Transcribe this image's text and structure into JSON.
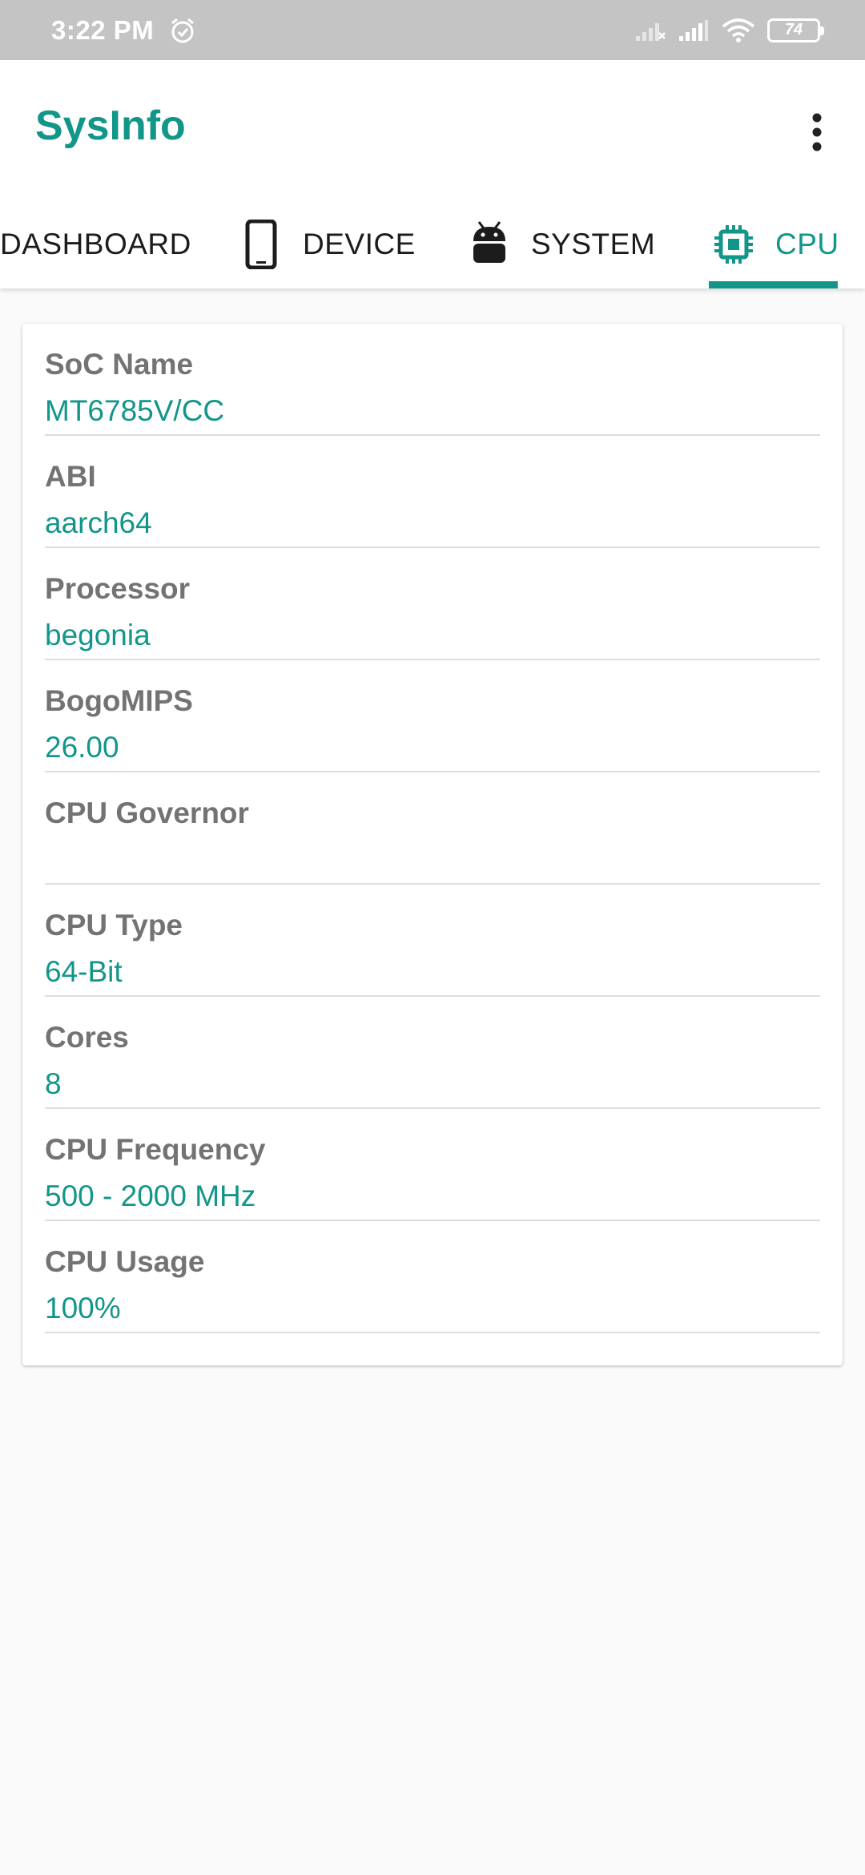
{
  "status_bar": {
    "time": "3:22 PM",
    "battery": "74"
  },
  "app": {
    "title": "SysInfo"
  },
  "tabs": [
    {
      "label": "DASHBOARD",
      "icon": "dashboard-icon",
      "active": false
    },
    {
      "label": "DEVICE",
      "icon": "phone-icon",
      "active": false
    },
    {
      "label": "SYSTEM",
      "icon": "android-icon",
      "active": false
    },
    {
      "label": "CPU",
      "icon": "chip-icon",
      "active": true
    }
  ],
  "cpu_info": [
    {
      "label": "SoC Name",
      "value": "MT6785V/CC"
    },
    {
      "label": "ABI",
      "value": "aarch64"
    },
    {
      "label": "Processor",
      "value": "begonia"
    },
    {
      "label": "BogoMIPS",
      "value": "26.00"
    },
    {
      "label": "CPU Governor",
      "value": ""
    },
    {
      "label": "CPU Type",
      "value": "64-Bit"
    },
    {
      "label": "Cores",
      "value": "8"
    },
    {
      "label": "CPU Frequency",
      "value": "500 - 2000 MHz"
    },
    {
      "label": "CPU Usage",
      "value": "100%"
    }
  ],
  "colors": {
    "accent": "#13968a",
    "label": "#737373",
    "status_bar": "#c4c4c4"
  }
}
